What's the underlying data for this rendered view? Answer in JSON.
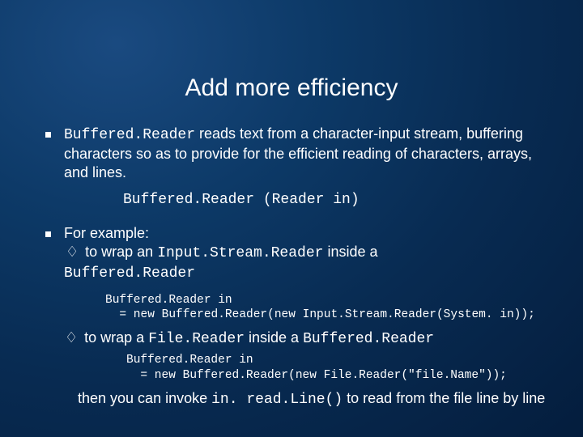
{
  "title": "Add more efficiency",
  "bullet1": {
    "code1": "Buffered.Reader",
    "text1": " reads text from a character-input stream, buffering characters so as to provide for the efficient reading of characters, arrays, and lines."
  },
  "constructor": "Buffered.Reader (Reader in)",
  "bullet2": {
    "lead": "For example:",
    "sub1_pre": "to wrap an ",
    "sub1_code1": "Input.Stream.Reader",
    "sub1_mid": " inside a ",
    "sub1_code2": "Buffered.Reader",
    "code_block1_l1": "Buffered.Reader in",
    "code_block1_l2": "  = new Buffered.Reader(new Input.Stream.Reader(System. in));",
    "sub2_pre": "to wrap a ",
    "sub2_code1": "File.Reader",
    "sub2_mid": " inside a ",
    "sub2_code2": "Buffered.Reader",
    "code_block2_l1": "Buffered.Reader in",
    "code_block2_l2": "  = new Buffered.Reader(new File.Reader(\"file.Name\"));",
    "closing_pre": "then you can invoke ",
    "closing_code": "in. read.Line()",
    "closing_post": " to read from the file line by line"
  }
}
